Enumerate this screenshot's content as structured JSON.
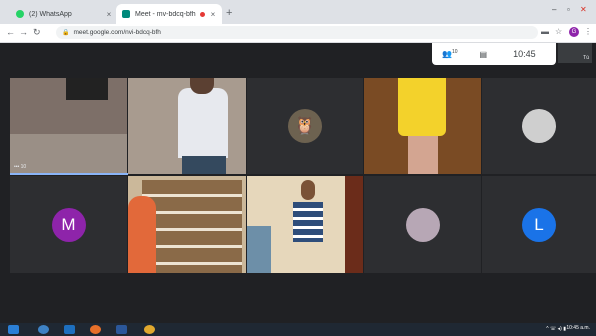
{
  "browser": {
    "tabs": [
      {
        "title": "(2) WhatsApp",
        "favicon": "whatsapp-icon",
        "color": "#25d366"
      },
      {
        "title": "Meet - mv-bdcq-bfh",
        "favicon": "meet-icon",
        "color": "#00897b"
      }
    ],
    "url": "meet.google.com/nvi-bdcq-bfh",
    "profile_initial": "G"
  },
  "meet": {
    "participants_icon": "people-icon",
    "participant_count": "10",
    "chat_icon": "chat-icon",
    "clock": "10:45",
    "self_view_label": "Tú",
    "tile_count_label": "••• 10",
    "tiles": [
      {
        "name": "M",
        "color": "#8e24aa"
      },
      {
        "name": "L",
        "color": "#1a73e8"
      }
    ]
  },
  "taskbar": {
    "tray": "^ ☏ ◂) ▮",
    "time": "10:45 a.m."
  }
}
